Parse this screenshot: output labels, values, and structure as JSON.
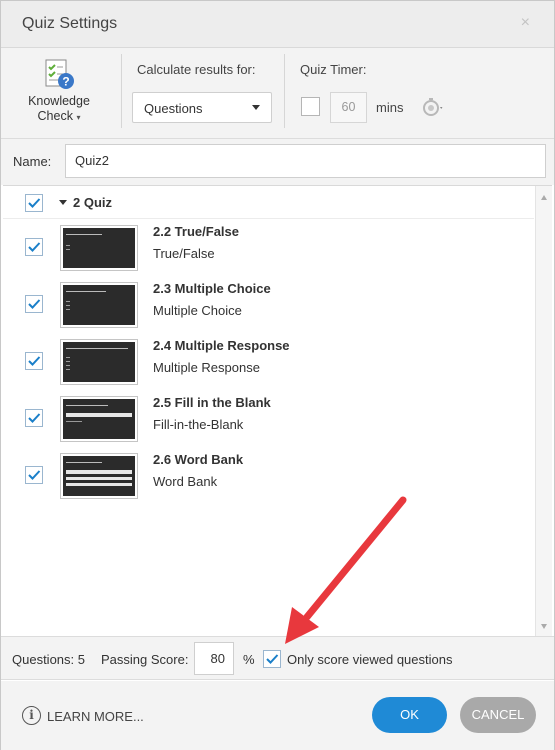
{
  "window": {
    "title": "Quiz Settings",
    "close_glyph": "×"
  },
  "toolbar": {
    "knowledge_check": {
      "line1": "Knowledge",
      "line2": "Check",
      "caret": "▾",
      "icon": "quiz-document-icon"
    },
    "calculate_label": "Calculate results for:",
    "calculate_value": "Questions",
    "timer_label": "Quiz Timer:",
    "timer_value": "60",
    "timer_unit": "mins",
    "timer_checked": false
  },
  "name": {
    "label": "Name:",
    "value": "Quiz2"
  },
  "group": {
    "label": "2 Quiz",
    "checked": true
  },
  "questions": [
    {
      "title": "2.2 True/False",
      "type": "True/False",
      "checked": true
    },
    {
      "title": "2.3 Multiple Choice",
      "type": "Multiple Choice",
      "checked": true
    },
    {
      "title": "2.4 Multiple Response",
      "type": "Multiple Response",
      "checked": true
    },
    {
      "title": "2.5 Fill in the Blank",
      "type": "Fill-in-the-Blank",
      "checked": true
    },
    {
      "title": "2.6 Word Bank",
      "type": "Word Bank",
      "checked": true
    }
  ],
  "footer": {
    "questions_count": "Questions: 5",
    "passing_label": "Passing Score:",
    "passing_value": "80",
    "percent": "%",
    "only_viewed_label": "Only score viewed questions",
    "only_viewed_checked": true
  },
  "actions": {
    "learn_more": "LEARN MORE...",
    "info_glyph": "i",
    "ok": "OK",
    "cancel": "CANCEL"
  },
  "colors": {
    "accent": "#1f8ad6",
    "cancel": "#a9a9a9",
    "annotation_arrow": "#e8383d",
    "checkmark": "#1a7fc9"
  }
}
